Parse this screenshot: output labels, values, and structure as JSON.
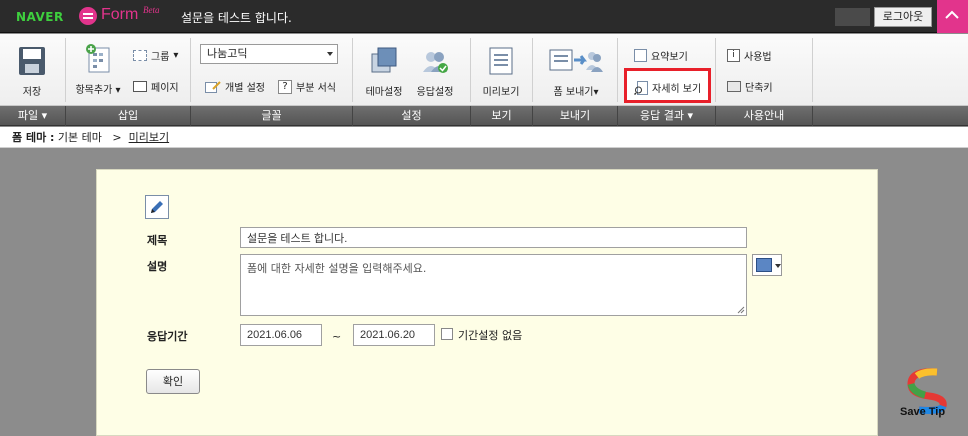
{
  "topbar": {
    "brand": "NAVER",
    "product": "Form",
    "beta": "Beta",
    "doc_title": "설문을 테스트 합니다.",
    "logout_label": "로그아웃"
  },
  "ribbon": {
    "save": "저장",
    "add_item": "항목추가",
    "group": "그룹",
    "page": "페이지",
    "font_value": "나눔고딕",
    "individual_setting": "개별 설정",
    "partial_format": "부분 서식",
    "theme_setting": "테마설정",
    "response_setting": "응답설정",
    "preview": "미리보기",
    "send_form": "폼 보내기",
    "summary_view": "요약보기",
    "detail_view": "자세히 보기",
    "usage": "사용법",
    "shortcut": "단축키"
  },
  "sections": [
    "파일",
    "삽입",
    "글꼴",
    "설정",
    "보기",
    "보내기",
    "응답 결과",
    "사용안내"
  ],
  "breadcrumb": {
    "label": "폼 테마 :",
    "theme": "기본 테마",
    "sep": ">",
    "link": "미리보기"
  },
  "form": {
    "title_label": "제목",
    "title_value": "설문을 테스트 합니다.",
    "desc_label": "설명",
    "desc_placeholder": "폼에 대한 자세한 설명을 입력해주세요.",
    "period_label": "응답기간",
    "start_date": "2021.06.06",
    "tilde": "~",
    "end_date": "2021.06.20",
    "no_period_label": "기간설정 없음",
    "confirm_label": "확인",
    "color_swatch": "#5b86c4"
  },
  "watermark": {
    "text": "Save Tip"
  },
  "colors": {
    "accent": "#e2348c",
    "naver": "#3ecf3e",
    "highlight": "#e8202a"
  }
}
